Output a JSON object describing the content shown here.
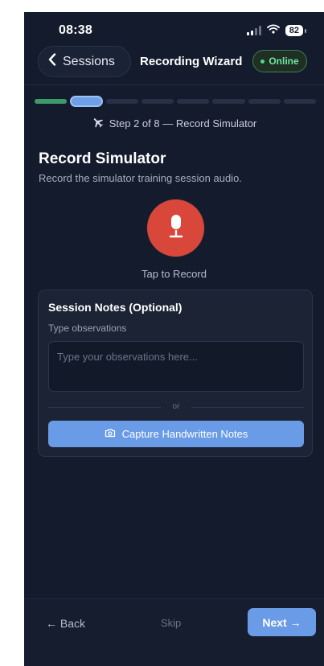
{
  "status_bar": {
    "time": "08:38",
    "battery": "82",
    "icons": [
      "signal-icon",
      "wifi-icon",
      "battery-icon"
    ]
  },
  "header": {
    "back_label": "Sessions",
    "title": "Recording Wizard",
    "status_badge": "Online"
  },
  "progress": {
    "current_step": 2,
    "total_steps": 8,
    "step_text": "Step 2 of 8 — Record Simulator",
    "icon": "airplane-icon"
  },
  "page": {
    "title": "Record Simulator",
    "subtitle": "Record the simulator training session audio."
  },
  "record": {
    "icon": "microphone-icon",
    "label": "Tap to Record"
  },
  "notes": {
    "title": "Session Notes (Optional)",
    "field_label": "Type observations",
    "placeholder": "Type your observations here...",
    "value": "",
    "divider_text": "or",
    "capture_label": "Capture Handwritten Notes",
    "capture_icon": "camera-icon"
  },
  "footer": {
    "back_label": "← Back",
    "skip_label": "Skip",
    "next_label": "Next →"
  },
  "colors": {
    "background": "#141b2d",
    "accent": "#6a9be6",
    "record": "#d9473b",
    "success": "#3c9b6b",
    "online": "#4ade80"
  }
}
